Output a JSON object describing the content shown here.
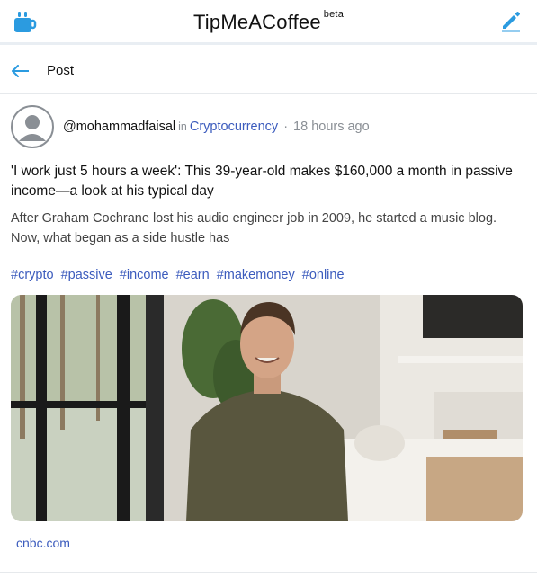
{
  "app": {
    "title": "TipMeACoffee",
    "badge": "beta",
    "accent": "#2b9be0"
  },
  "header": {
    "back_icon": "arrow-left-icon",
    "title": "Post"
  },
  "post": {
    "author": "@mohammadfaisal",
    "in_label": "in",
    "community": "Cryptocurrency",
    "separator": "·",
    "time": "18 hours ago",
    "headline": "'I work just 5 hours a week': This 39-year-old makes $160,000 a month in passive income—a look at his typical day",
    "excerpt": "After Graham Cochrane lost his audio engineer job in 2009, he started a music blog. Now, what began as a side hustle has",
    "tags": [
      "#crypto",
      "#passive",
      "#income",
      "#earn",
      "#makemoney",
      "#online"
    ],
    "source": "cnbc.com",
    "link_color": "#3b5bbd"
  }
}
